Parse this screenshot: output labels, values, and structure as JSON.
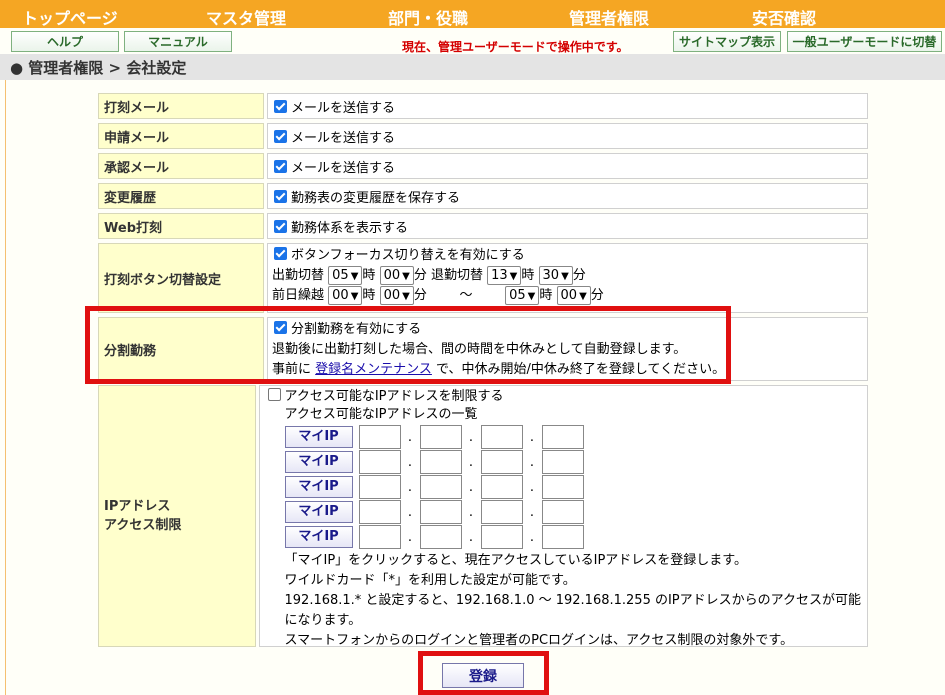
{
  "nav": {
    "items": [
      "トップページ",
      "マスタ管理",
      "部門・役職",
      "管理者権限",
      "安否確認"
    ]
  },
  "subbar": {
    "help": "ヘルプ",
    "manual": "マニュアル",
    "mode_message": "現在、管理ユーザーモードで操作中です。",
    "sitemap": "サイトマップ表示",
    "switch_user": "一般ユーザーモードに切替"
  },
  "breadcrumb": "● 管理者権限 > 会社設定",
  "rows": {
    "punch_mail": {
      "label": "打刻メール",
      "text": "メールを送信する",
      "checked": true
    },
    "request_mail": {
      "label": "申請メール",
      "text": "メールを送信する",
      "checked": true
    },
    "approve_mail": {
      "label": "承認メール",
      "text": "メールを送信する",
      "checked": true
    },
    "history": {
      "label": "変更履歴",
      "text": "勤務表の変更履歴を保存する",
      "checked": true
    },
    "web_punch": {
      "label": "Web打刻",
      "text": "勤務体系を表示する",
      "checked": true
    },
    "punch_switch": {
      "label": "打刻ボタン切替設定",
      "text": "ボタンフォーカス切り替えを有効にする",
      "checked": true,
      "in_label": "出勤切替",
      "in_hour": "05",
      "in_min": "00",
      "out_label": "退勤切替",
      "out_hour": "13",
      "out_min": "30",
      "prev_label": "前日繰越",
      "prev_hour": "00",
      "prev_min": "00",
      "tilde": "～",
      "end_hour": "05",
      "end_min": "00",
      "hour_unit": "時",
      "min_unit": "分"
    },
    "split": {
      "label": "分割勤務",
      "text": "分割勤務を有効にする",
      "checked": true,
      "desc": "退勤後に出勤打刻した場合、間の時間を中休みとして自動登録します。",
      "pre": "事前に",
      "link": "登録名メンテナンス",
      "post": "で、中休み開始/中休み終了を登録してください。"
    },
    "ip": {
      "label_line1": "IPアドレス",
      "label_line2": "アクセス制限",
      "text": "アクセス可能なIPアドレスを制限する",
      "checked": false,
      "list_title": "アクセス可能なIPアドレスの一覧",
      "myip": "マイIP",
      "dot": ".",
      "note1": "「マイIP」をクリックすると、現在アクセスしているIPアドレスを登録します。",
      "note2": "ワイルドカード「*」を利用した設定が可能です。",
      "note3": "192.168.1.* と設定すると、192.168.1.0 ～ 192.168.1.255 のIPアドレスからのアクセスが可能",
      "note4": "になります。",
      "note5": "スマートフォンからのログインと管理者のPCログインは、アクセス制限の対象外です。"
    }
  },
  "submit": "登録",
  "colors": {
    "nav": "#f5a623",
    "label_bg": "#ffffcc",
    "highlight": "#e01010",
    "mode_msg": "#d40000"
  }
}
